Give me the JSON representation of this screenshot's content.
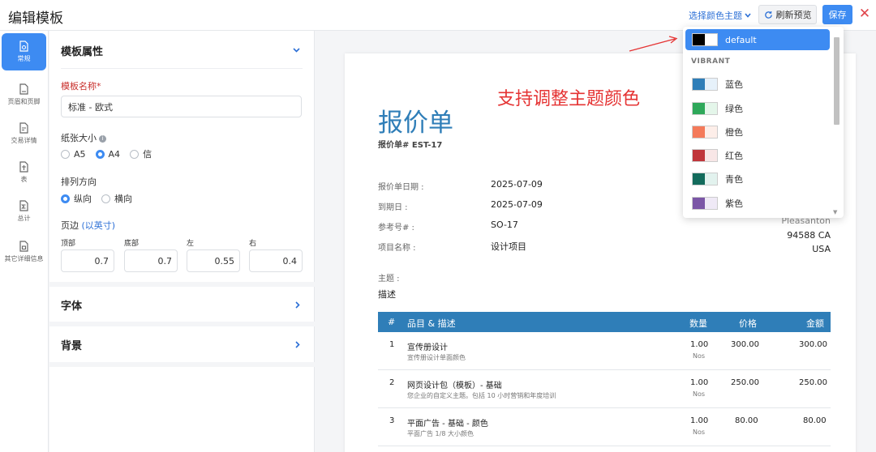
{
  "header": {
    "title": "编辑模板",
    "theme_select": "选择颜色主题",
    "refresh": "刷新预览",
    "save": "保存",
    "close": "✕"
  },
  "rail": [
    {
      "label": "常规",
      "icon": "file-settings-icon"
    },
    {
      "label": "页眉和页脚",
      "icon": "file-header-icon"
    },
    {
      "label": "交易详情",
      "icon": "file-detail-icon"
    },
    {
      "label": "表",
      "icon": "table-icon"
    },
    {
      "label": "总计",
      "icon": "sum-icon"
    },
    {
      "label": "其它详细信息",
      "icon": "file-info-icon"
    }
  ],
  "panel": {
    "section": "模板属性",
    "name_label": "模板名称",
    "name_value": "标准 - 欧式",
    "paper_label": "纸张大小",
    "paper_options": [
      "A5",
      "A4",
      "信"
    ],
    "paper_selected": "A4",
    "orientation_label": "排列方向",
    "orientation_options": [
      "纵向",
      "横向"
    ],
    "orientation_selected": "纵向",
    "margin_label": "页边",
    "margin_unit": "(以英寸)",
    "margins": [
      {
        "label": "顶部",
        "value": "0.7"
      },
      {
        "label": "底部",
        "value": "0.7"
      },
      {
        "label": "左",
        "value": "0.55"
      },
      {
        "label": "右",
        "value": "0.4"
      }
    ],
    "font_section": "字体",
    "bg_section": "背景"
  },
  "doc": {
    "title": "报价单",
    "number": "报价单# EST-17",
    "annotation": "支持调整主题颜色",
    "meta": [
      {
        "k": "报价单日期 :",
        "v": "2025-07-09"
      },
      {
        "k": "到期日 :",
        "v": "2025-07-09"
      },
      {
        "k": "参考号# :",
        "v": "SO-17"
      },
      {
        "k": "项目名称 :",
        "v": "设计项目"
      }
    ],
    "address": [
      "Pleasanton",
      "94588 CA",
      "USA"
    ],
    "subject_label": "主题 :",
    "subject_value": "描述",
    "table": {
      "headers": {
        "num": "#",
        "item": "品目 & 描述",
        "qty": "数量",
        "rate": "价格",
        "amount": "金额"
      },
      "rows": [
        {
          "n": "1",
          "name": "宣传册设计",
          "desc": "宣传册设计单面颜色",
          "qty": "1.00",
          "unit": "Nos",
          "rate": "300.00",
          "amount": "300.00"
        },
        {
          "n": "2",
          "name": "网页设计包（模板）- 基础",
          "desc": "您企业的自定义主题。包括 10 小时营销和年度培训",
          "qty": "1.00",
          "unit": "Nos",
          "rate": "250.00",
          "amount": "250.00"
        },
        {
          "n": "3",
          "name": "平面广告 - 基础 - 颜色",
          "desc": "平面广告 1/8 大小颜色",
          "qty": "1.00",
          "unit": "Nos",
          "rate": "80.00",
          "amount": "80.00"
        }
      ]
    }
  },
  "dropdown": {
    "selected": {
      "label": "default",
      "c1": "#000000",
      "c2": "#ffffff"
    },
    "group": "VIBRANT",
    "items": [
      {
        "label": "蓝色",
        "c1": "#2f7eb8",
        "c2": "#e6f1fa"
      },
      {
        "label": "绿色",
        "c1": "#2ea85a",
        "c2": "#e4f6ea"
      },
      {
        "label": "橙色",
        "c1": "#f47a5a",
        "c2": "#fdeee9"
      },
      {
        "label": "红色",
        "c1": "#c0353a",
        "c2": "#f8e6e6"
      },
      {
        "label": "青色",
        "c1": "#136b5c",
        "c2": "#e2f2ee"
      },
      {
        "label": "紫色",
        "c1": "#7b56a6",
        "c2": "#efe9f6"
      }
    ]
  },
  "colors": {
    "accent": "#3d8bf2",
    "doc_theme": "#2f7eb8",
    "annotation": "#e53333"
  }
}
